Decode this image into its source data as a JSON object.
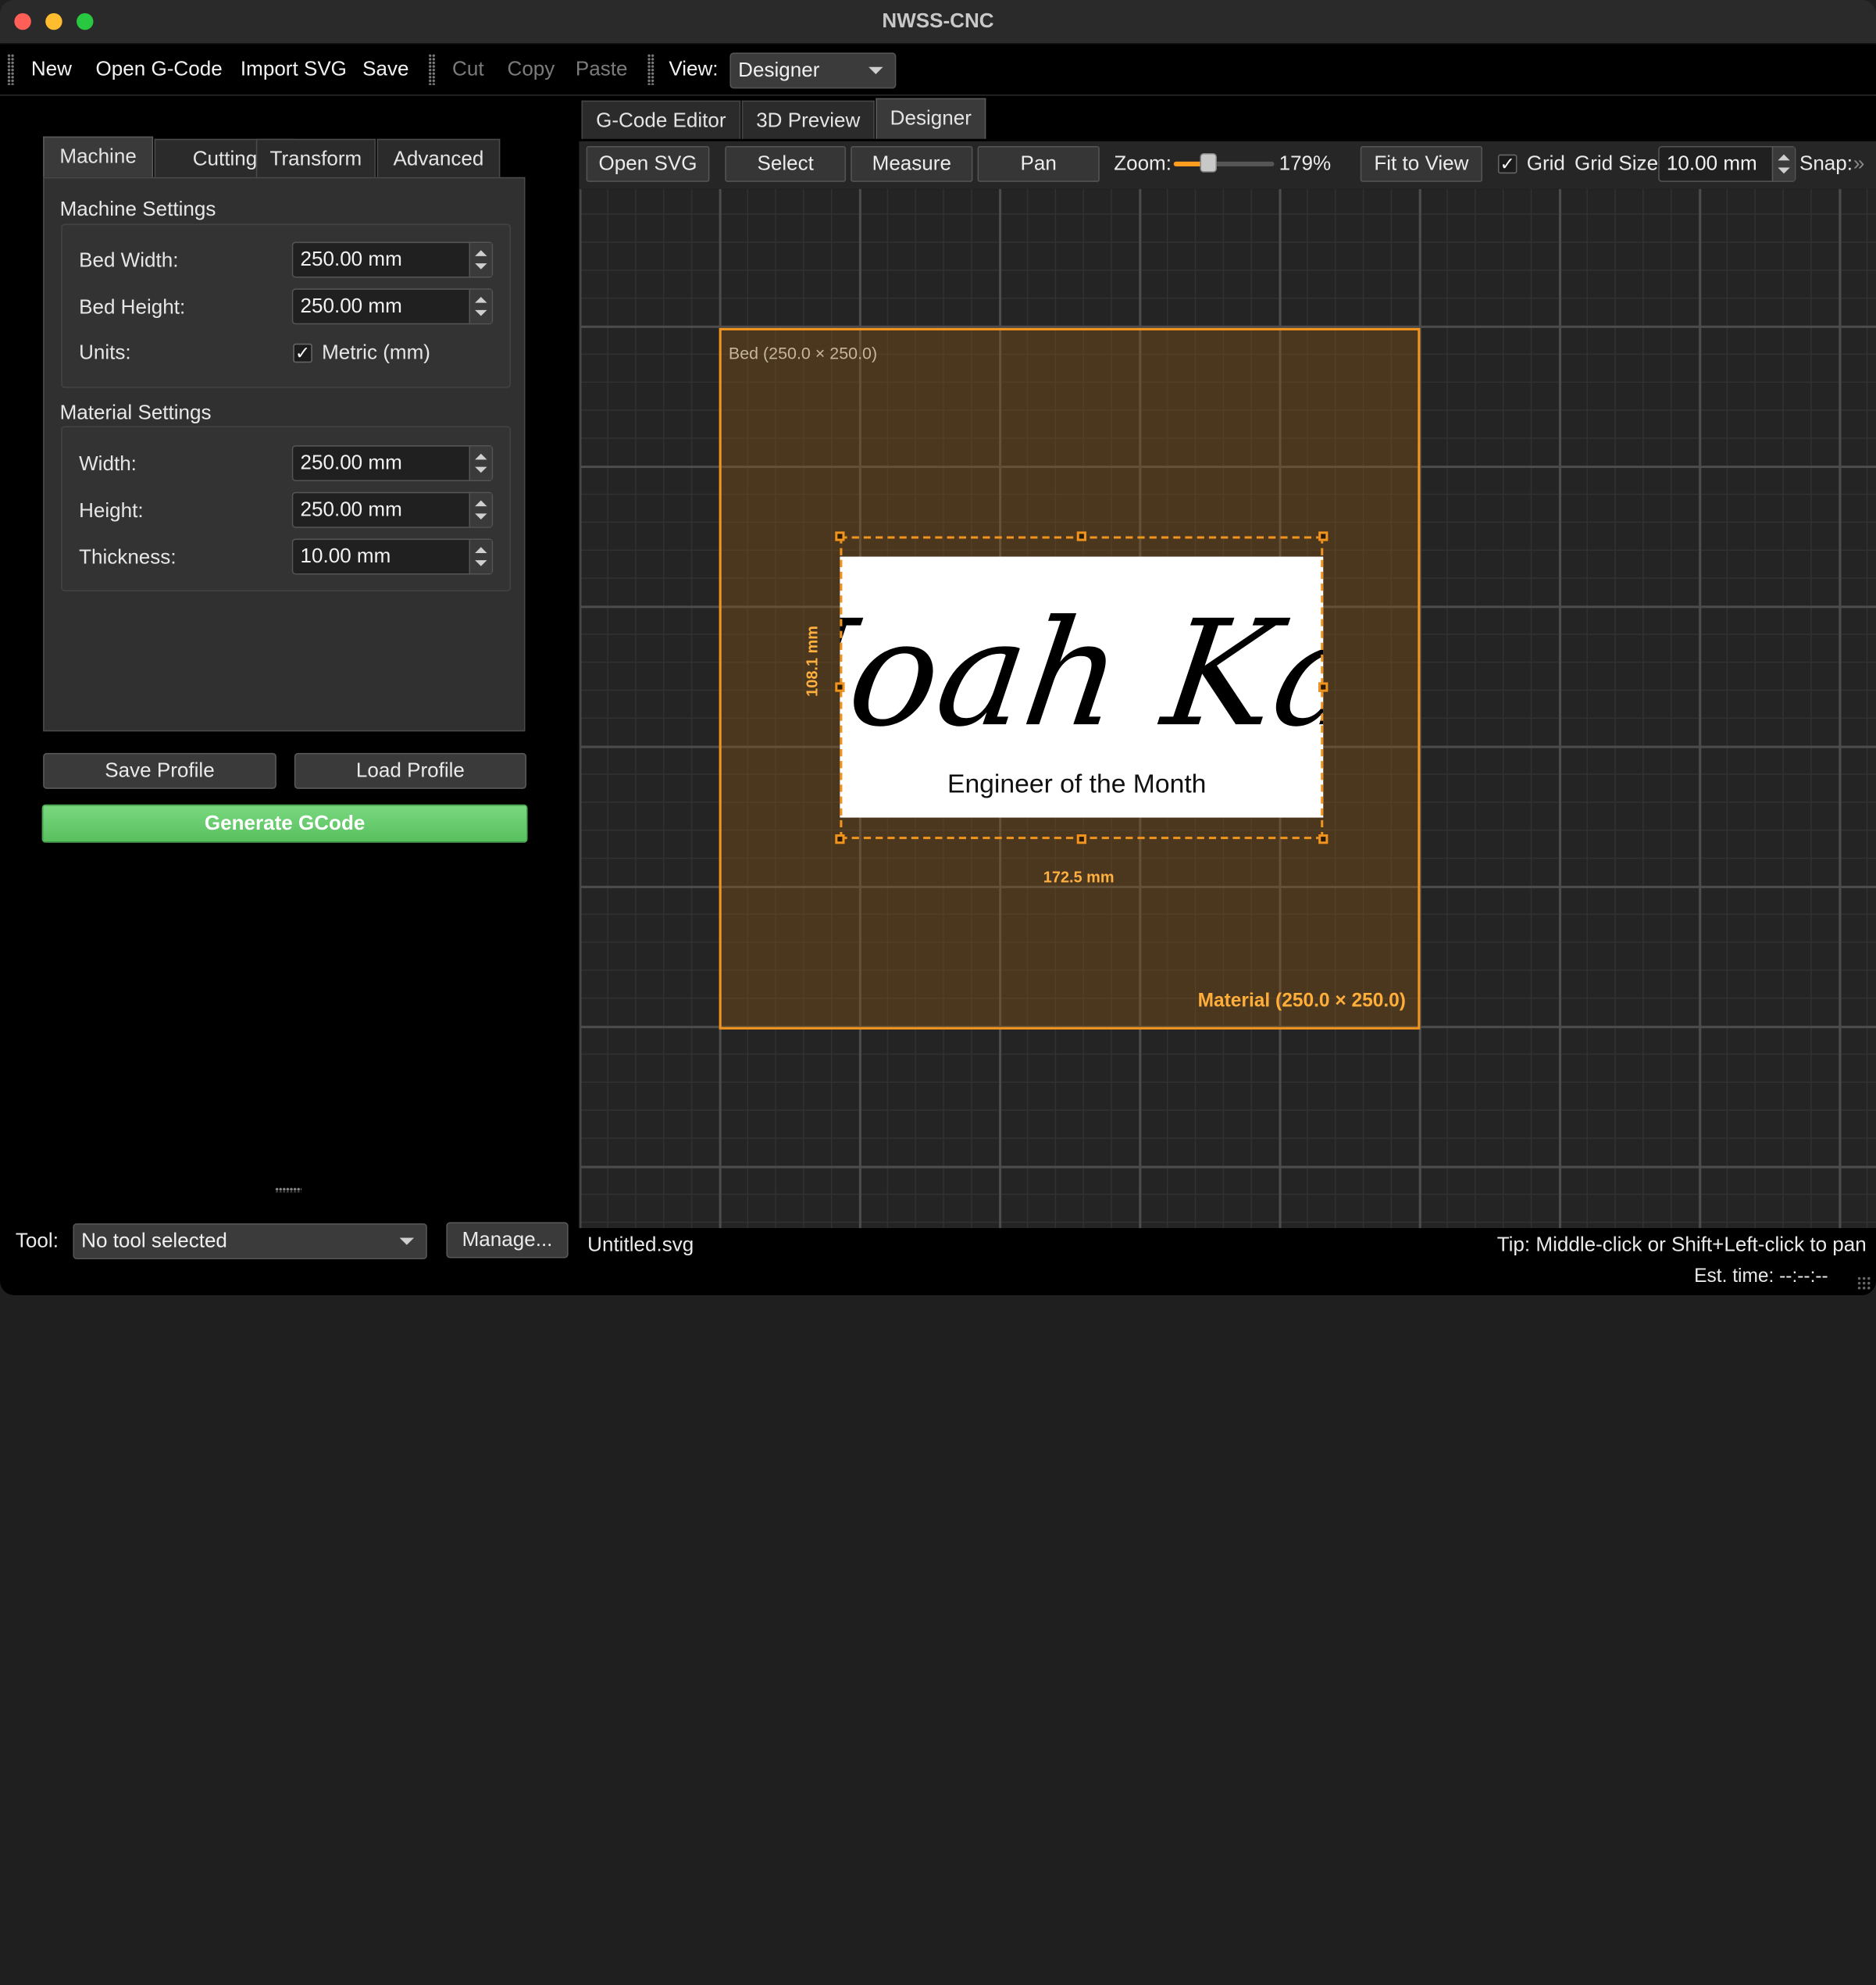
{
  "window": {
    "title": "NWSS-CNC"
  },
  "toolbar": {
    "new": "New",
    "open_gcode": "Open G-Code",
    "import_svg": "Import SVG",
    "save": "Save",
    "cut": "Cut",
    "copy": "Copy",
    "paste": "Paste",
    "view_label": "View:",
    "view_value": "Designer"
  },
  "left_tabs": [
    "Machine",
    "Cutting",
    "Transform",
    "Advanced"
  ],
  "machine_settings": {
    "title": "Machine Settings",
    "bed_width_label": "Bed Width:",
    "bed_width": "250.00 mm",
    "bed_height_label": "Bed Height:",
    "bed_height": "250.00 mm",
    "units_label": "Units:",
    "units_checkbox": "Metric (mm)",
    "units_checked": true
  },
  "material_settings": {
    "title": "Material Settings",
    "width_label": "Width:",
    "width": "250.00 mm",
    "height_label": "Height:",
    "height": "250.00 mm",
    "thickness_label": "Thickness:",
    "thickness": "10.00 mm"
  },
  "profile": {
    "save": "Save Profile",
    "load": "Load Profile"
  },
  "generate": "Generate GCode",
  "tool": {
    "label": "Tool:",
    "value": "No tool selected",
    "manage": "Manage..."
  },
  "right_tabs": [
    "G-Code Editor",
    "3D Preview",
    "Designer"
  ],
  "designer_toolbar": {
    "open_svg": "Open SVG",
    "select": "Select",
    "measure": "Measure",
    "pan": "Pan",
    "zoom_label": "Zoom:",
    "zoom_value": "179%",
    "zoom_fraction": 0.35,
    "fit_to_view": "Fit to View",
    "grid_label": "Grid",
    "grid_checked": true,
    "grid_size_label": "Grid Size:",
    "grid_size": "10.00 mm",
    "snap_label": "Snap:",
    "overflow": "»"
  },
  "canvas": {
    "bed_label": "Bed (250.0 × 250.0)",
    "material_label": "Material (250.0 × 250.0)",
    "svg_name_text": "Noah Kay",
    "svg_subtitle": "Engineer of the Month",
    "width_dim": "172.5 mm",
    "height_dim": "108.1 mm"
  },
  "status": {
    "filename": "Untitled.svg",
    "tip": "Tip: Middle-click or Shift+Left-click to pan",
    "est_time": "Est. time: --:--:--"
  },
  "colors": {
    "accent": "#f0941e",
    "generate_green": "#5ec865",
    "canvas_bg": "#242424"
  }
}
